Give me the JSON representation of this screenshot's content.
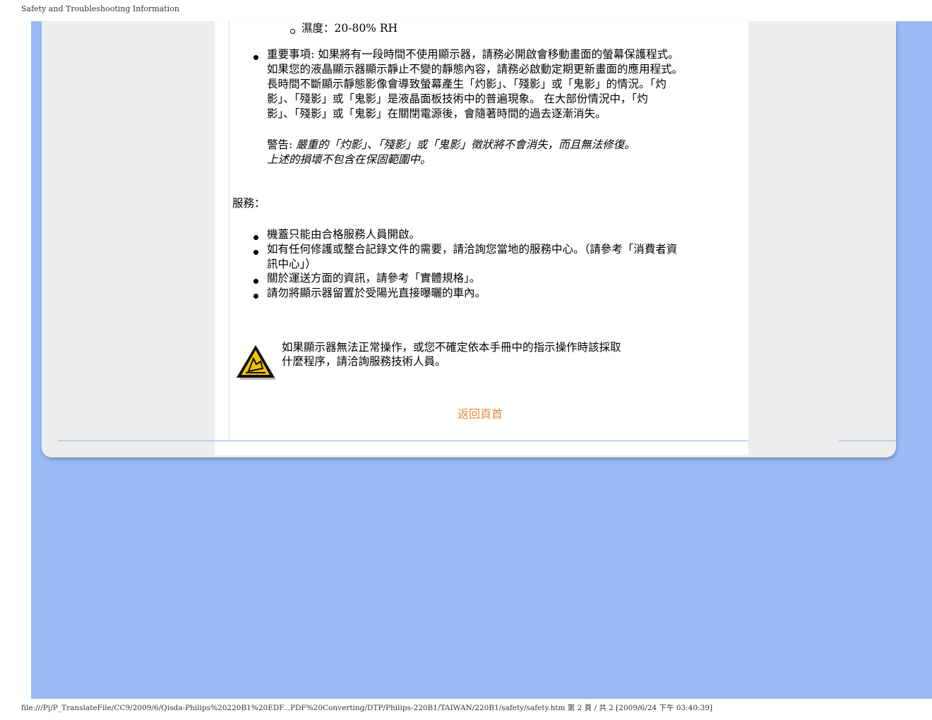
{
  "header": {
    "title": "Safety and Troubleshooting Information"
  },
  "footer": {
    "path": "file:///P|/P_TranslateFile/CC9/2009/6/Qisda-Philips%20220B1%20EDF...PDF%20Converting/DTP/Philips-220B1/TAIWAN/220B1/safety/safety.htm 第 2 頁 / 共 2  [2009/6/24 下午 03:40:39]"
  },
  "humidity": "濕度：20-80% RH",
  "important": {
    "lines": [
      "重要事項: 如果將有一段時間不使用顯示器，請務必開啟會移動畫面的螢幕保護程式。",
      "如果您的液晶顯示器顯示靜止不變的靜態內容，請務必啟動定期更新畫面的應用程式。",
      "長時間不斷顯示靜態影像會導致螢幕產生「灼影」、「殘影」或「鬼影」的情況。「灼",
      "影」、「殘影」或「鬼影」是液晶面板技術中的普遍現象。 在大部份情況中，「灼",
      "影」、「殘影」或「鬼影」在關閉電源後，會隨著時間的過去逐漸消失。"
    ]
  },
  "warning": {
    "label": "警告: ",
    "line1": "嚴重的「灼影」、「殘影」或「鬼影」徵狀將不會消失，而且無法修復。",
    "line2": "上述的損壞不包含在保固範圍中。"
  },
  "service": {
    "heading": "服務：",
    "items": [
      "機蓋只能由合格服務人員開啟。",
      "如有任何修護或整合記錄文件的需要，請洽詢您當地的服務中心。（請參考「消費者資",
      "訊中心」）",
      "關於運送方面的資訊，請參考「實體規格」。",
      "請勿將顯示器留置於受陽光直接曝曬的車內。"
    ]
  },
  "caution": {
    "line1": "如果顯示器無法正常操作，或您不確定依本手冊中的指示操作時該採取",
    "line2": "什麼程序，請洽詢服務技術人員。",
    "icon": "warning-triangle-icon"
  },
  "back_to_top": "返回頁首",
  "colors": {
    "background_blue": "#99b9f7",
    "link": "#e88a3c",
    "frame": "#ededed"
  }
}
